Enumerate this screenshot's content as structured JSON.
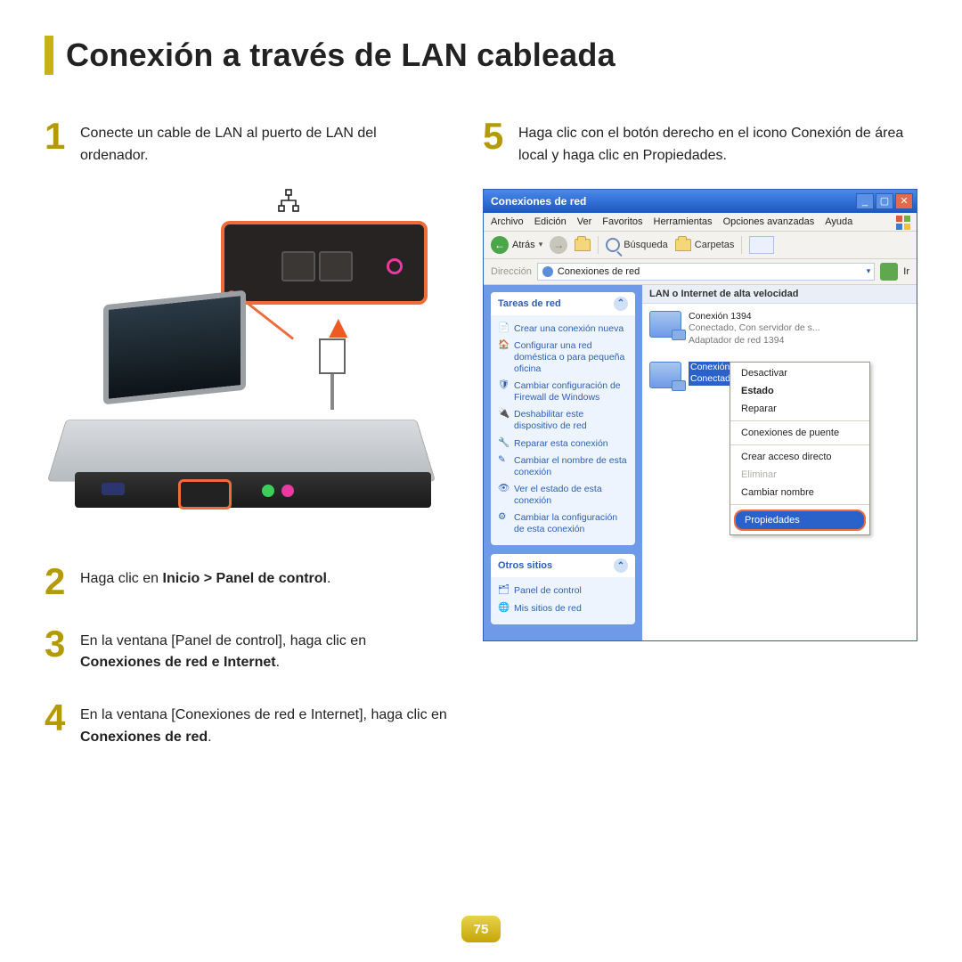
{
  "page": {
    "title": "Conexión a través de LAN cableada",
    "number": "75"
  },
  "steps": {
    "s1": {
      "num": "1",
      "text": "Conecte un cable de LAN al puerto de LAN del ordenador."
    },
    "s2": {
      "num": "2",
      "prefix": "Haga clic en ",
      "bold": "Inicio > Panel de control",
      "suffix": "."
    },
    "s3": {
      "num": "3",
      "prefix": "En la ventana [Panel de control], haga clic en ",
      "bold": "Conexiones de red e Internet",
      "suffix": "."
    },
    "s4": {
      "num": "4",
      "prefix": "En la ventana [Conexiones de red e Internet], haga clic en ",
      "bold": "Conexiones de red",
      "suffix": "."
    },
    "s5": {
      "num": "5",
      "text": "Haga clic con el botón derecho en el icono Conexión de área local y haga clic en Propiedades."
    }
  },
  "icons": {
    "network_glyph": "⧉"
  },
  "xp": {
    "title": "Conexiones de red",
    "menubar": [
      "Archivo",
      "Edición",
      "Ver",
      "Favoritos",
      "Herramientas",
      "Opciones avanzadas",
      "Ayuda"
    ],
    "toolbar": {
      "back": "Atrás",
      "search": "Búsqueda",
      "folders": "Carpetas"
    },
    "address": {
      "label": "Dirección",
      "value": "Conexiones de red",
      "go": "Ir"
    },
    "side": {
      "panel1": {
        "title": "Tareas de red",
        "items": [
          "Crear una conexión nueva",
          "Configurar una red doméstica o para pequeña oficina",
          "Cambiar configuración de Firewall de Windows",
          "Deshabilitar este dispositivo de red",
          "Reparar esta conexión",
          "Cambiar el nombre de esta conexión",
          "Ver el estado de esta conexión",
          "Cambiar la configuración de esta conexión"
        ]
      },
      "panel2": {
        "title": "Otros sitios",
        "items": [
          "Panel de control",
          "Mis sitios de red"
        ]
      }
    },
    "main": {
      "section": "LAN o Internet de alta velocidad",
      "conn1": {
        "name": "Conexión 1394",
        "sub1": "Conectado, Con servidor de s...",
        "sub2": "Adaptador de red 1394"
      },
      "conn2": {
        "name": "Conexión de área local",
        "sub1": "Conectado, Con servidor de s..."
      }
    },
    "context": {
      "items": [
        {
          "label": "Desactivar",
          "type": "normal"
        },
        {
          "label": "Estado",
          "type": "bold"
        },
        {
          "label": "Reparar",
          "type": "normal"
        },
        {
          "label": "Conexiones de puente",
          "type": "normal",
          "sepBefore": true
        },
        {
          "label": "Crear acceso directo",
          "type": "normal",
          "sepBefore": true
        },
        {
          "label": "Eliminar",
          "type": "disabled"
        },
        {
          "label": "Cambiar nombre",
          "type": "normal"
        },
        {
          "label": "Propiedades",
          "type": "highlight",
          "sepBefore": true
        }
      ]
    }
  }
}
